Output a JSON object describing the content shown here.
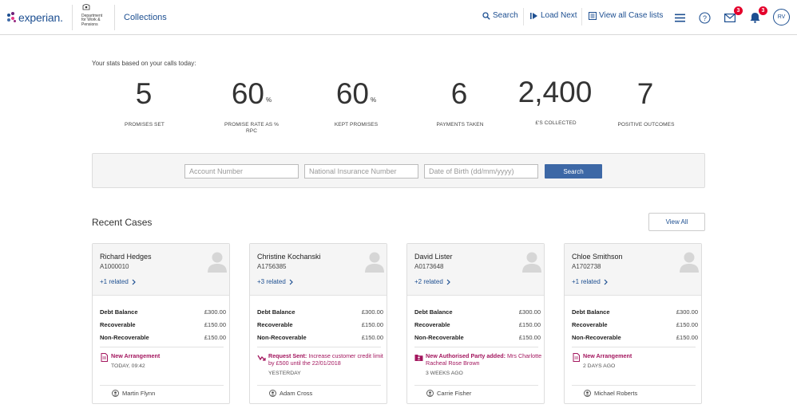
{
  "header": {
    "logo_text": "experian.",
    "partner_logo_lines": [
      "Department",
      "for Work &",
      "Pensions"
    ],
    "app_title": "Collections",
    "nav": {
      "search": "Search",
      "load_next": "Load Next",
      "view_all_case_lists": "View all Case lists"
    },
    "icons": [
      "menu-icon",
      "help-icon",
      "mail-icon",
      "bell-icon"
    ],
    "mail_badge": "3",
    "notification_badge": "3",
    "user_initials": "RV",
    "colors": {
      "brand": "#1d4f91",
      "badge": "#e4002b"
    }
  },
  "stats": {
    "intro": "Your stats based on your calls today:",
    "items": [
      {
        "value": "5",
        "suffix": "",
        "label": "PROMISES SET"
      },
      {
        "value": "60",
        "suffix": "%",
        "label": "PROMISE RATE AS % RPC"
      },
      {
        "value": "60",
        "suffix": "%",
        "label": "KEPT PROMISES"
      },
      {
        "value": "6",
        "suffix": "",
        "label": "PAYMENTS TAKEN"
      },
      {
        "value": "2,400",
        "suffix": "",
        "label": "£'S COLLECTED"
      },
      {
        "value": "7",
        "suffix": "",
        "label": "POSITIVE OUTCOMES"
      }
    ]
  },
  "search_panel": {
    "account_placeholder": "Account Number",
    "ni_placeholder": "National Insurance Number",
    "dob_placeholder": "Date of Birth (dd/mm/yyyy)",
    "button": "Search"
  },
  "recent_cases": {
    "title": "Recent Cases",
    "view_all": "View All",
    "cards": [
      {
        "name": "Richard Hedges",
        "account": "A1000010",
        "related": "+1 related",
        "rows": [
          {
            "label": "Debt Balance",
            "value": "£300.00"
          },
          {
            "label": "Recoverable",
            "value": "£150.00"
          },
          {
            "label": "Non-Recoverable",
            "value": "£150.00"
          }
        ],
        "activity_title": "New Arrangement",
        "activity_detail": "",
        "activity_time": "TODAY, 09:42",
        "activity_icon": "document-icon",
        "agent": "Martin Flynn"
      },
      {
        "name": "Christine Kochanski",
        "account": "A1756385",
        "related": "+3 related",
        "rows": [
          {
            "label": "Debt Balance",
            "value": "£300.00"
          },
          {
            "label": "Recoverable",
            "value": "£150.00"
          },
          {
            "label": "Non-Recoverable",
            "value": "£150.00"
          }
        ],
        "activity_title": "Request Sent:",
        "activity_detail": " Increase customer credit limit by £500 until the 22/01/2018",
        "activity_time": "YESTERDAY",
        "activity_icon": "request-arrow-icon",
        "agent": "Adam Cross"
      },
      {
        "name": "David Lister",
        "account": "A0173648",
        "related": "+2 related",
        "rows": [
          {
            "label": "Debt Balance",
            "value": "£300.00"
          },
          {
            "label": "Recoverable",
            "value": "£150.00"
          },
          {
            "label": "Non-Recoverable",
            "value": "£150.00"
          }
        ],
        "activity_title": "New Authorised Party added:",
        "activity_detail": " Mrs Charlotte Racheal Rose Brown",
        "activity_time": "3 WEEKS AGO",
        "activity_icon": "person-card-icon",
        "agent": "Carrie Fisher"
      },
      {
        "name": "Chloe Smithson",
        "account": "A1702738",
        "related": "+1 related",
        "rows": [
          {
            "label": "Debt Balance",
            "value": "£300.00"
          },
          {
            "label": "Recoverable",
            "value": "£150.00"
          },
          {
            "label": "Non-Recoverable",
            "value": "£150.00"
          }
        ],
        "activity_title": "New Arrangement",
        "activity_detail": "",
        "activity_time": "2 DAYS AGO",
        "activity_icon": "document-icon",
        "agent": "Michael Roberts"
      }
    ]
  }
}
